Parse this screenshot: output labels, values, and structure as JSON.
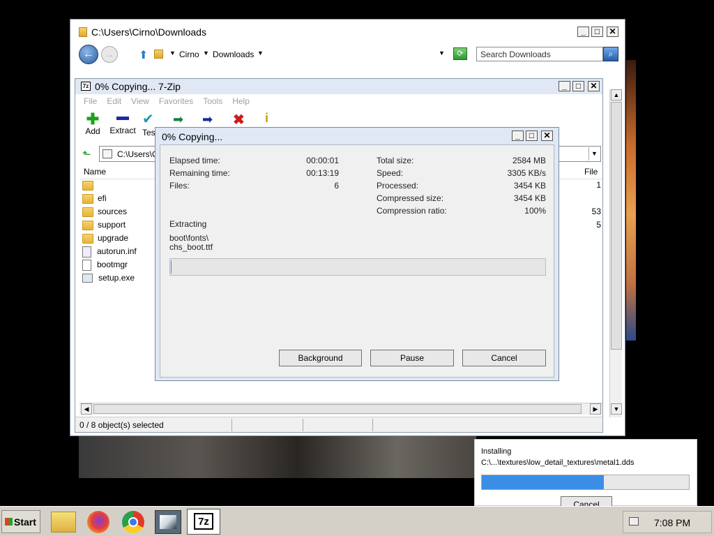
{
  "explorer": {
    "title": "C:\\Users\\Cirno\\Downloads",
    "breadcrumb": [
      "Cirno",
      "Downloads"
    ],
    "search_placeholder": "Search Downloads"
  },
  "sevenzip": {
    "title": "0% Copying... 7-Zip",
    "menu": [
      "File",
      "Edit",
      "View",
      "Favorites",
      "Tools",
      "Help"
    ],
    "toolbar": [
      "Add",
      "Extract",
      "Tes"
    ],
    "path": "C:\\Users\\C",
    "columns": {
      "name": "Name",
      "files": "File"
    },
    "files": [
      {
        "name": "",
        "icon": "folder-icon",
        "count": "1"
      },
      {
        "name": "efi",
        "icon": "folder-icon",
        "count": ""
      },
      {
        "name": "sources",
        "icon": "folder-icon",
        "count": "53"
      },
      {
        "name": "support",
        "icon": "folder-icon",
        "count": "5"
      },
      {
        "name": "upgrade",
        "icon": "folder-icon",
        "count": ""
      },
      {
        "name": "autorun.inf",
        "icon": "settings-file-icon",
        "count": ""
      },
      {
        "name": "bootmgr",
        "icon": "file-icon",
        "count": ""
      },
      {
        "name": "setup.exe",
        "icon": "exe-icon",
        "count": ""
      }
    ],
    "status": "0 / 8 object(s) selected"
  },
  "progress_dialog": {
    "title": "0% Copying...",
    "left_stats": [
      {
        "label": "Elapsed time:",
        "value": "00:00:01"
      },
      {
        "label": "Remaining time:",
        "value": "00:13:19"
      },
      {
        "label": "Files:",
        "value": "6"
      }
    ],
    "right_stats": [
      {
        "label": "Total size:",
        "value": "2584 MB"
      },
      {
        "label": "Speed:",
        "value": "3305 KB/s"
      },
      {
        "label": "Processed:",
        "value": "3454 KB"
      },
      {
        "label": "Compressed size:",
        "value": "3454 KB"
      },
      {
        "label": "Compression ratio:",
        "value": "100%"
      }
    ],
    "action": "Extracting",
    "current_path": "boot\\fonts\\",
    "current_file": "chs_boot.ttf",
    "progress": 0.0,
    "buttons": {
      "background": "Background",
      "pause": "Pause",
      "cancel": "Cancel"
    }
  },
  "installer": {
    "label": "Installing",
    "path": "C:\\...\\textures\\low_detail_textures\\metal1.dds",
    "progress": 0.59,
    "cancel": "Cancel"
  },
  "taskbar": {
    "start": "Start",
    "time": "7:08 PM",
    "apps": [
      "file-explorer-icon",
      "firefox-icon",
      "chrome-icon",
      "installer-app-icon",
      "7zip-icon"
    ]
  },
  "colors": {
    "accent": "#3399ff",
    "titlebar": "#dfe8f4",
    "progress_fill": "#3a8ee6"
  }
}
